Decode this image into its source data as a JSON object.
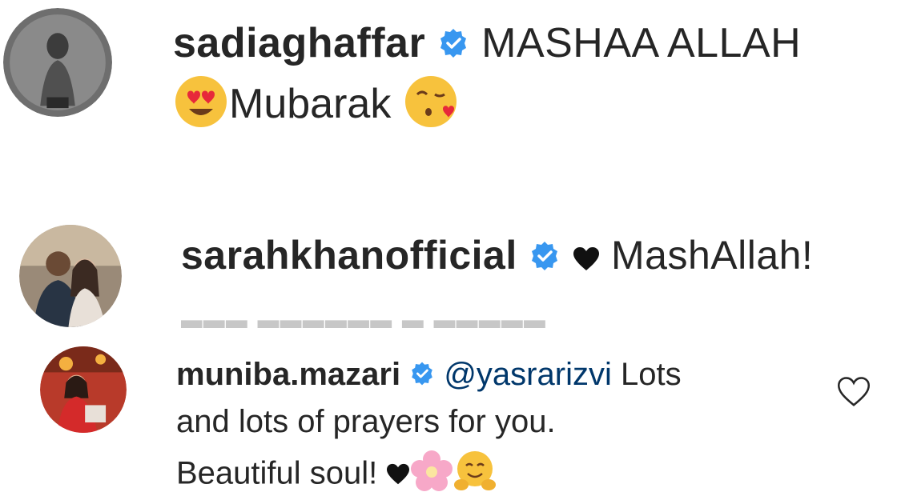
{
  "comments": [
    {
      "username": "sadiaghaffar",
      "verified": true,
      "line1_text": "MASHAA ALLAH",
      "line2_text": "Mubarak",
      "emojis": [
        "heart-eyes-emoji",
        "kissing-heart-emoji"
      ]
    },
    {
      "username": "sarahkhanofficial",
      "verified": true,
      "text": "MashAllah!",
      "emojis": [
        "black-heart-emoji"
      ]
    },
    {
      "username": "muniba.mazari",
      "verified": true,
      "mention": "@yasrarizvi",
      "line1_text": "Lots",
      "line2_text": "and lots of prayers for you.",
      "line3_text": "Beautiful soul!",
      "emojis": [
        "black-heart-emoji",
        "cherry-blossom-emoji",
        "hugging-face-emoji"
      ]
    }
  ],
  "colors": {
    "verified": "#3897f0",
    "mention": "#00376b",
    "text": "#262626"
  },
  "icons": [
    "verified-badge-icon",
    "heart-outline-icon"
  ]
}
